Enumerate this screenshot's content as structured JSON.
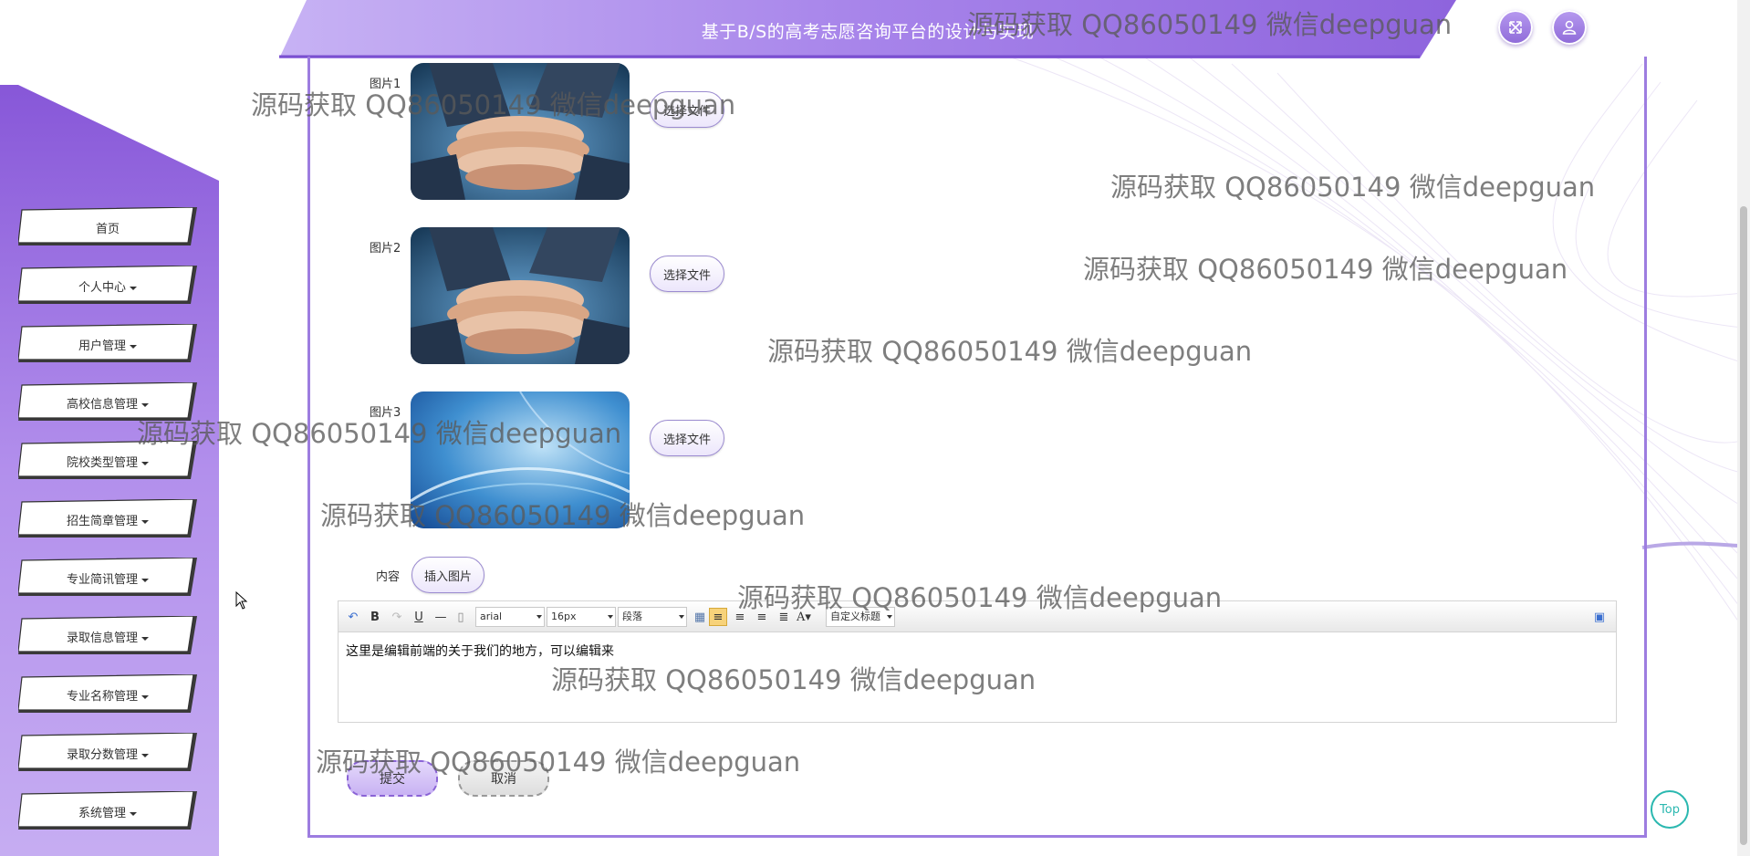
{
  "header": {
    "title": "基于B/S的高考志愿咨询平台的设计与实现",
    "fullscreen_icon": "expand-icon",
    "user_icon": "user-icon"
  },
  "sidebar": {
    "items": [
      {
        "label": "首页",
        "has_caret": false
      },
      {
        "label": "个人中心",
        "has_caret": true
      },
      {
        "label": "用户管理",
        "has_caret": true
      },
      {
        "label": "高校信息管理",
        "has_caret": true
      },
      {
        "label": "院校类型管理",
        "has_caret": true
      },
      {
        "label": "招生简章管理",
        "has_caret": true
      },
      {
        "label": "专业简讯管理",
        "has_caret": true
      },
      {
        "label": "录取信息管理",
        "has_caret": true
      },
      {
        "label": "专业名称管理",
        "has_caret": true
      },
      {
        "label": "录取分数管理",
        "has_caret": true
      },
      {
        "label": "系统管理",
        "has_caret": true
      }
    ]
  },
  "form": {
    "image1_label": "图片1",
    "image2_label": "图片2",
    "image3_label": "图片3",
    "choose_file_label": "选择文件",
    "content_label": "内容",
    "insert_image_label": "插入图片",
    "editor": {
      "font": "arial",
      "size": "16px",
      "paragraph": "段落",
      "custom_title": "自定义标题",
      "content": "这里是编辑前端的关于我们的地方，可以编辑来"
    },
    "submit_label": "提交",
    "cancel_label": "取消"
  },
  "top_button_label": "Top",
  "watermark_text": "源码获取 QQ86050149 微信deepguan",
  "colors": {
    "primary_purple": "#9d7de0",
    "sidebar_purple": "#8b5cd8",
    "top_button": "#2bb8b0"
  }
}
